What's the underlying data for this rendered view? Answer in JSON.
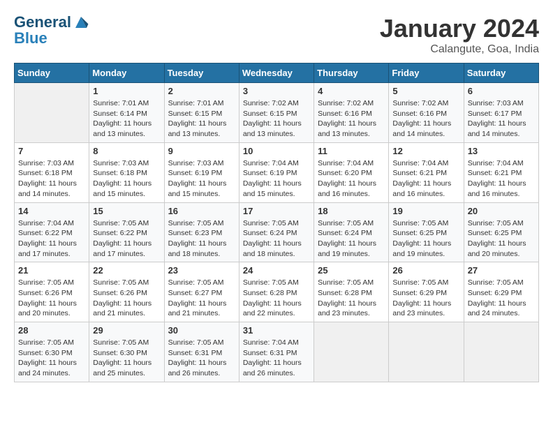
{
  "header": {
    "logo_line1": "General",
    "logo_line2": "Blue",
    "month": "January 2024",
    "location": "Calangute, Goa, India"
  },
  "days_of_week": [
    "Sunday",
    "Monday",
    "Tuesday",
    "Wednesday",
    "Thursday",
    "Friday",
    "Saturday"
  ],
  "weeks": [
    [
      {
        "num": "",
        "info": ""
      },
      {
        "num": "1",
        "info": "Sunrise: 7:01 AM\nSunset: 6:14 PM\nDaylight: 11 hours and 13 minutes."
      },
      {
        "num": "2",
        "info": "Sunrise: 7:01 AM\nSunset: 6:15 PM\nDaylight: 11 hours and 13 minutes."
      },
      {
        "num": "3",
        "info": "Sunrise: 7:02 AM\nSunset: 6:15 PM\nDaylight: 11 hours and 13 minutes."
      },
      {
        "num": "4",
        "info": "Sunrise: 7:02 AM\nSunset: 6:16 PM\nDaylight: 11 hours and 13 minutes."
      },
      {
        "num": "5",
        "info": "Sunrise: 7:02 AM\nSunset: 6:16 PM\nDaylight: 11 hours and 14 minutes."
      },
      {
        "num": "6",
        "info": "Sunrise: 7:03 AM\nSunset: 6:17 PM\nDaylight: 11 hours and 14 minutes."
      }
    ],
    [
      {
        "num": "7",
        "info": "Sunrise: 7:03 AM\nSunset: 6:18 PM\nDaylight: 11 hours and 14 minutes."
      },
      {
        "num": "8",
        "info": "Sunrise: 7:03 AM\nSunset: 6:18 PM\nDaylight: 11 hours and 15 minutes."
      },
      {
        "num": "9",
        "info": "Sunrise: 7:03 AM\nSunset: 6:19 PM\nDaylight: 11 hours and 15 minutes."
      },
      {
        "num": "10",
        "info": "Sunrise: 7:04 AM\nSunset: 6:19 PM\nDaylight: 11 hours and 15 minutes."
      },
      {
        "num": "11",
        "info": "Sunrise: 7:04 AM\nSunset: 6:20 PM\nDaylight: 11 hours and 16 minutes."
      },
      {
        "num": "12",
        "info": "Sunrise: 7:04 AM\nSunset: 6:21 PM\nDaylight: 11 hours and 16 minutes."
      },
      {
        "num": "13",
        "info": "Sunrise: 7:04 AM\nSunset: 6:21 PM\nDaylight: 11 hours and 16 minutes."
      }
    ],
    [
      {
        "num": "14",
        "info": "Sunrise: 7:04 AM\nSunset: 6:22 PM\nDaylight: 11 hours and 17 minutes."
      },
      {
        "num": "15",
        "info": "Sunrise: 7:05 AM\nSunset: 6:22 PM\nDaylight: 11 hours and 17 minutes."
      },
      {
        "num": "16",
        "info": "Sunrise: 7:05 AM\nSunset: 6:23 PM\nDaylight: 11 hours and 18 minutes."
      },
      {
        "num": "17",
        "info": "Sunrise: 7:05 AM\nSunset: 6:24 PM\nDaylight: 11 hours and 18 minutes."
      },
      {
        "num": "18",
        "info": "Sunrise: 7:05 AM\nSunset: 6:24 PM\nDaylight: 11 hours and 19 minutes."
      },
      {
        "num": "19",
        "info": "Sunrise: 7:05 AM\nSunset: 6:25 PM\nDaylight: 11 hours and 19 minutes."
      },
      {
        "num": "20",
        "info": "Sunrise: 7:05 AM\nSunset: 6:25 PM\nDaylight: 11 hours and 20 minutes."
      }
    ],
    [
      {
        "num": "21",
        "info": "Sunrise: 7:05 AM\nSunset: 6:26 PM\nDaylight: 11 hours and 20 minutes."
      },
      {
        "num": "22",
        "info": "Sunrise: 7:05 AM\nSunset: 6:26 PM\nDaylight: 11 hours and 21 minutes."
      },
      {
        "num": "23",
        "info": "Sunrise: 7:05 AM\nSunset: 6:27 PM\nDaylight: 11 hours and 21 minutes."
      },
      {
        "num": "24",
        "info": "Sunrise: 7:05 AM\nSunset: 6:28 PM\nDaylight: 11 hours and 22 minutes."
      },
      {
        "num": "25",
        "info": "Sunrise: 7:05 AM\nSunset: 6:28 PM\nDaylight: 11 hours and 23 minutes."
      },
      {
        "num": "26",
        "info": "Sunrise: 7:05 AM\nSunset: 6:29 PM\nDaylight: 11 hours and 23 minutes."
      },
      {
        "num": "27",
        "info": "Sunrise: 7:05 AM\nSunset: 6:29 PM\nDaylight: 11 hours and 24 minutes."
      }
    ],
    [
      {
        "num": "28",
        "info": "Sunrise: 7:05 AM\nSunset: 6:30 PM\nDaylight: 11 hours and 24 minutes."
      },
      {
        "num": "29",
        "info": "Sunrise: 7:05 AM\nSunset: 6:30 PM\nDaylight: 11 hours and 25 minutes."
      },
      {
        "num": "30",
        "info": "Sunrise: 7:05 AM\nSunset: 6:31 PM\nDaylight: 11 hours and 26 minutes."
      },
      {
        "num": "31",
        "info": "Sunrise: 7:04 AM\nSunset: 6:31 PM\nDaylight: 11 hours and 26 minutes."
      },
      {
        "num": "",
        "info": ""
      },
      {
        "num": "",
        "info": ""
      },
      {
        "num": "",
        "info": ""
      }
    ]
  ]
}
